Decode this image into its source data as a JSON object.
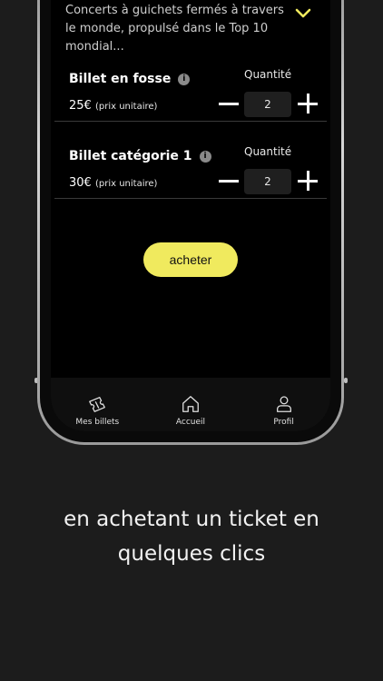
{
  "event": {
    "description": "Concerts à guichets fermés à travers le monde, propulsé dans le Top 10 mondial..."
  },
  "tickets": [
    {
      "name": "Billet en fosse",
      "price": "25€",
      "price_unit": "(prix unitaire)",
      "qty_label": "Quantité",
      "qty": "2"
    },
    {
      "name": "Billet catégorie 1",
      "price": "30€",
      "price_unit": "(prix unitaire)",
      "qty_label": "Quantité",
      "qty": "2"
    }
  ],
  "buy_label": "acheter",
  "tabs": [
    {
      "label": "Mes billets",
      "icon": "ticket-icon"
    },
    {
      "label": "Accueil",
      "icon": "home-icon"
    },
    {
      "label": "Profil",
      "icon": "user-icon"
    }
  ],
  "caption": {
    "line1": "en achetant un ticket en",
    "line2": "quelques clics"
  },
  "colors": {
    "accent": "#f0ea5e",
    "background": "#1c1c1c",
    "screen": "#000000"
  }
}
